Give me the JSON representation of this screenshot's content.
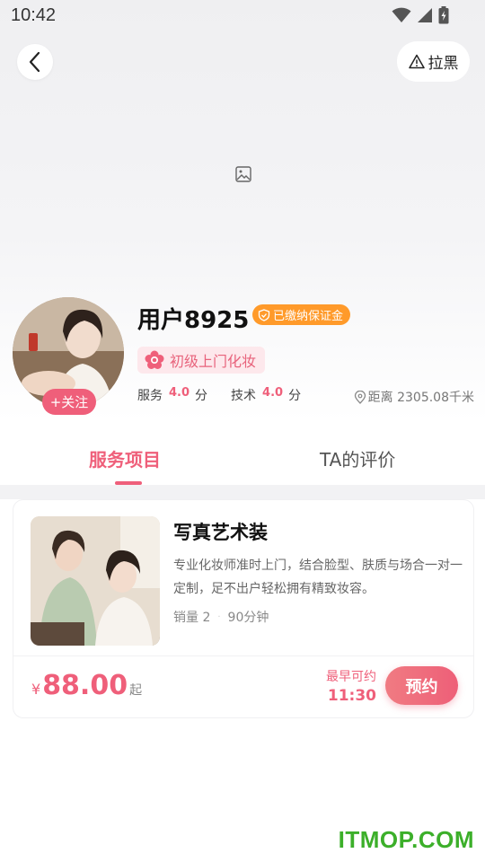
{
  "status_bar": {
    "time": "10:42"
  },
  "header": {
    "block_label": "拉黑"
  },
  "profile": {
    "follow_label": "+关注",
    "name": "用户8925",
    "deposit_badge": "已缴纳保证金",
    "level": "初级上门化妆",
    "service_label": "服务",
    "service_score": "4.0",
    "tech_label": "技术",
    "tech_score": "4.0",
    "score_unit": "分",
    "distance": "距离 2305.08千米"
  },
  "tabs": [
    {
      "label": "服务项目",
      "active": true
    },
    {
      "label": "TA的评价",
      "active": false
    }
  ],
  "service": {
    "title": "写真艺术装",
    "description": "专业化妆师准时上门，结合脸型、肤质与场合一对一定制，足不出户轻松拥有精致妆容。",
    "sales": "销量 2",
    "duration": "90分钟",
    "currency": "¥",
    "price": "88.00",
    "price_suffix": "起",
    "earliest_label": "最早可约",
    "earliest_time": "11:30",
    "book_label": "预约"
  },
  "watermark": "ITMOP.COM",
  "colors": {
    "accent": "#ef5f7a",
    "badge_orange": "#ff9a2a",
    "watermark_green": "#3caf2a"
  },
  "icons": [
    "wifi-icon",
    "signal-icon",
    "battery-icon",
    "back-arrow-icon",
    "warning-icon",
    "image-placeholder-icon",
    "shield-icon",
    "flower-icon",
    "location-pin-icon"
  ]
}
